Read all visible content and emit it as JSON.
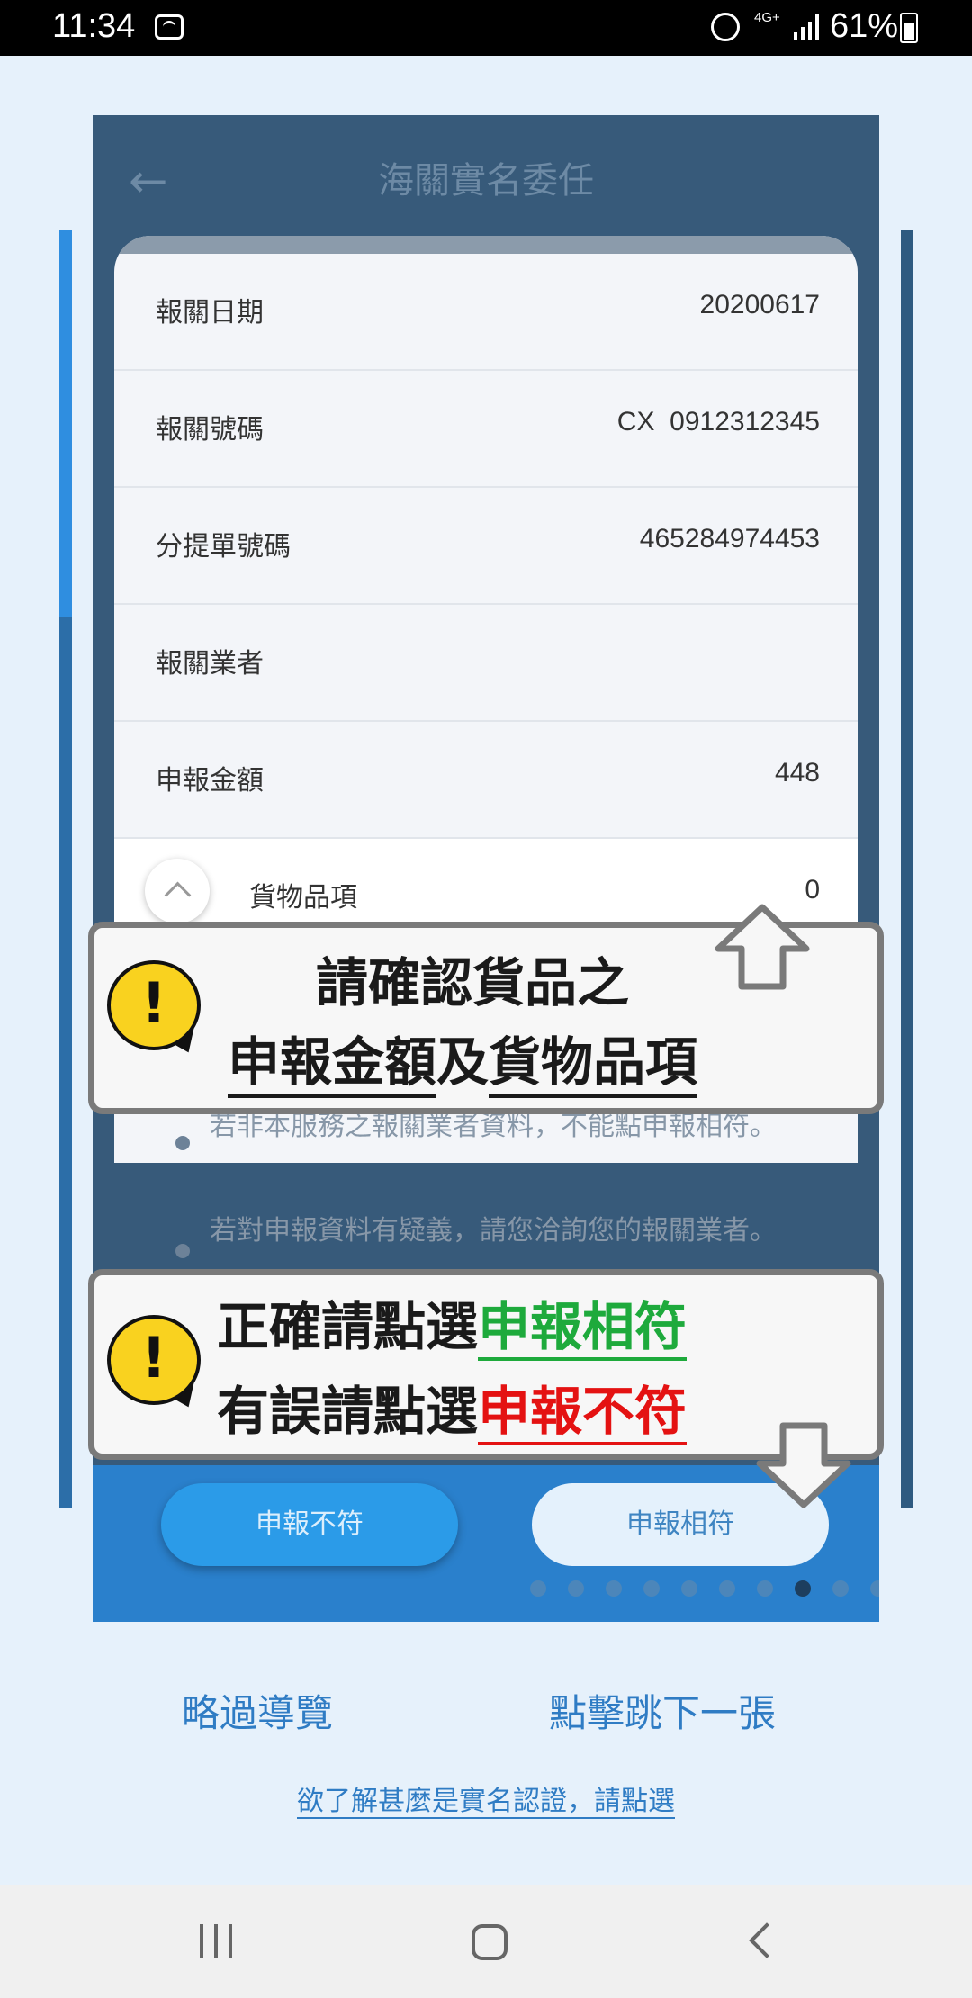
{
  "status_bar": {
    "time": "11:34",
    "network": "4G+",
    "battery": "61%"
  },
  "slide": {
    "header_title": "海關實名委任",
    "rows": [
      {
        "label": "報關日期",
        "value": "20200617"
      },
      {
        "label": "報關號碼",
        "value": "CX  0912312345"
      },
      {
        "label": "分提單號碼",
        "value": "465284974453"
      },
      {
        "label": "報關業者",
        "value": ""
      },
      {
        "label": "申報金額",
        "value": "448"
      },
      {
        "label": "貨物品項",
        "value": "0"
      }
    ],
    "notes": [
      "若非本服務之報關業者資料，不能點申報相符。",
      "若對申報資料有疑義，請您洽詢您的報關業者。"
    ],
    "buttons": {
      "reject": "申報不符",
      "accept": "申報相符"
    },
    "page_indicator": {
      "total": 10,
      "active_index": 7
    }
  },
  "callouts": {
    "first": {
      "line1": "請確認貨品之",
      "line2_a": "申報金額",
      "line2_b": "及",
      "line2_c": "貨物品項"
    },
    "second": {
      "line1_prefix": "正確請點選",
      "line1_highlight": "申報相符",
      "line2_prefix": "有誤請點選",
      "line2_highlight": "申報不符"
    },
    "colors": {
      "green": "#1eaa3c",
      "red": "#e41212",
      "warning": "#f9d21f"
    }
  },
  "footer": {
    "skip": "略過導覽",
    "next": "點擊跳下一張",
    "learn_more": "欲了解甚麼是實名認證，請點選"
  }
}
